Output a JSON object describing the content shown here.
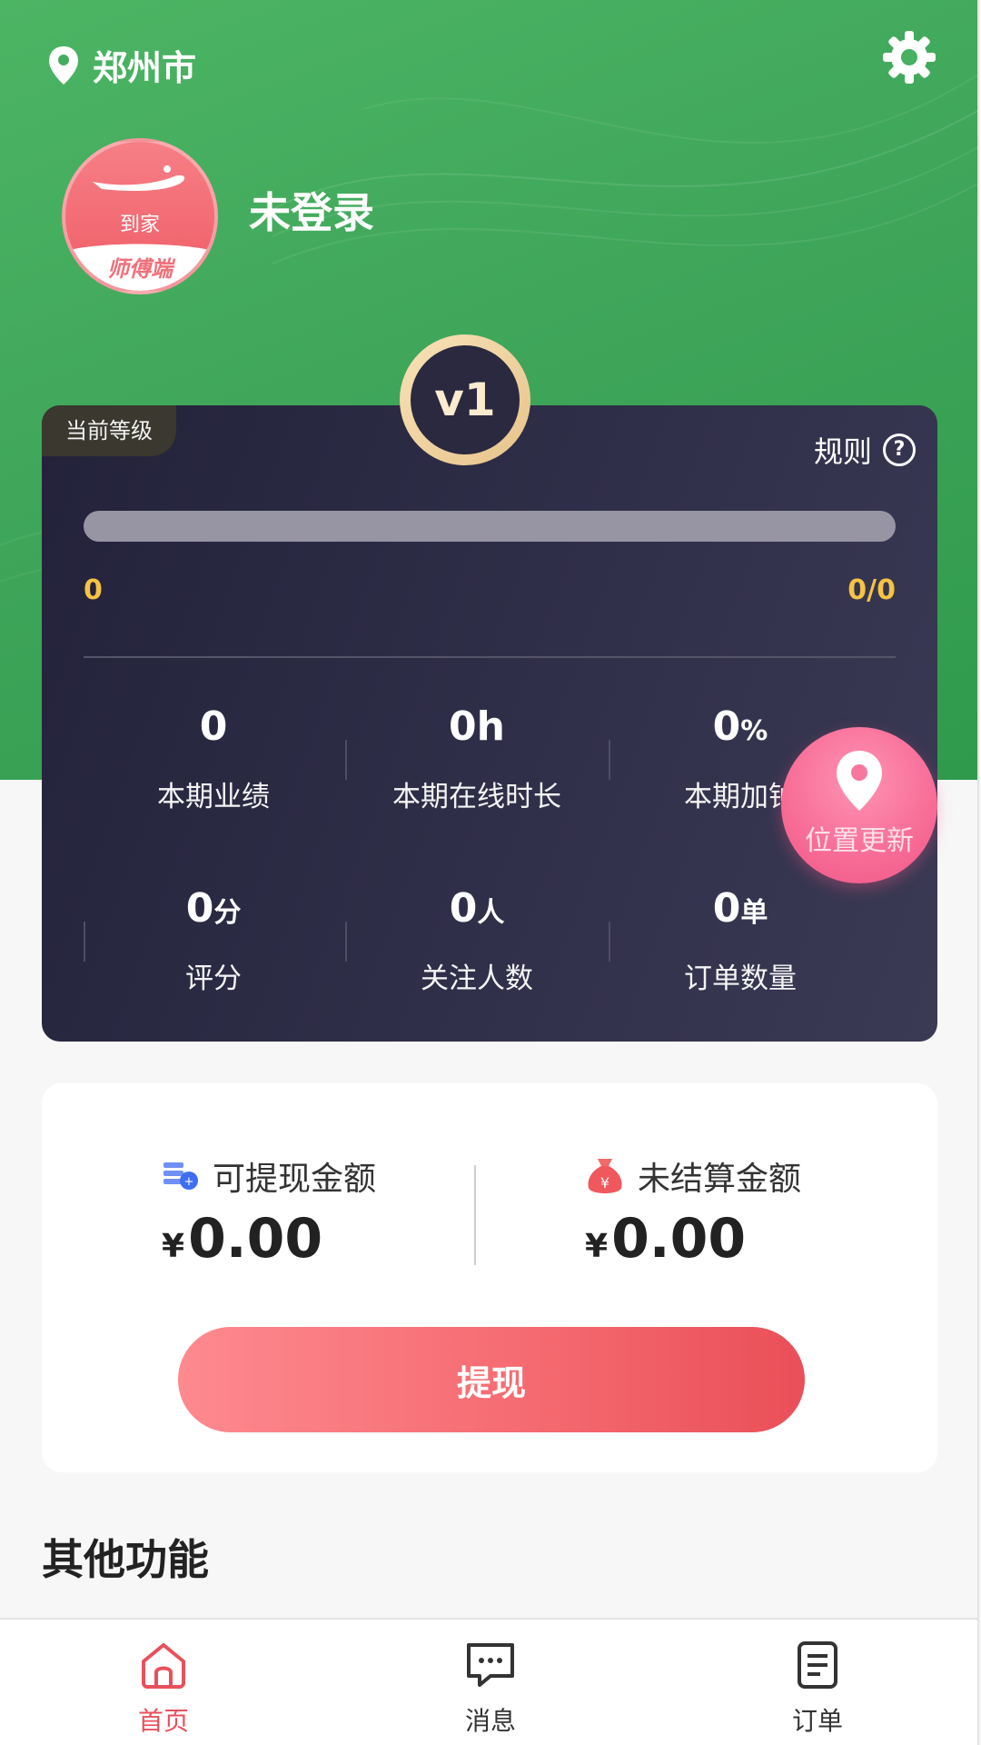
{
  "header": {
    "city": "郑州市",
    "user_name": "未登录",
    "avatar_text_top": "到家",
    "avatar_text_bottom": "师傅端"
  },
  "level_card": {
    "tag": "当前等级",
    "rule_label": "规则",
    "rule_icon_text": "?",
    "level_badge": "v1",
    "progress": 0,
    "progress_left": "0",
    "progress_right": "0/0",
    "stats_row1": [
      {
        "value": "0",
        "unit": "",
        "label": "本期业绩"
      },
      {
        "value": "0h",
        "unit": "",
        "label": "本期在线时长"
      },
      {
        "value": "0",
        "unit": "%",
        "label": "本期加钟"
      }
    ],
    "stats_row2": [
      {
        "value": "0",
        "unit": "分",
        "label": "评分"
      },
      {
        "value": "0",
        "unit": "人",
        "label": "关注人数"
      },
      {
        "value": "0",
        "unit": "单",
        "label": "订单数量"
      }
    ]
  },
  "location_update": {
    "label": "位置更新"
  },
  "wallet": {
    "withdrawable": {
      "label": "可提现金额",
      "currency": "¥",
      "amount": "0.00"
    },
    "unsettled": {
      "label": "未结算金额",
      "currency": "¥",
      "amount": "0.00"
    },
    "button": "提现"
  },
  "other_section": {
    "title": "其他功能"
  },
  "tabbar": {
    "items": [
      {
        "label": "首页",
        "active": true
      },
      {
        "label": "消息",
        "active": false
      },
      {
        "label": "订单",
        "active": false
      }
    ]
  },
  "colors": {
    "header_green": "#3fa65a",
    "card_dark": "#2f2e48",
    "accent_gold": "#f6c343",
    "primary_red": "#f56b71",
    "pink": "#f76c96",
    "tab_active": "#e8505b"
  }
}
